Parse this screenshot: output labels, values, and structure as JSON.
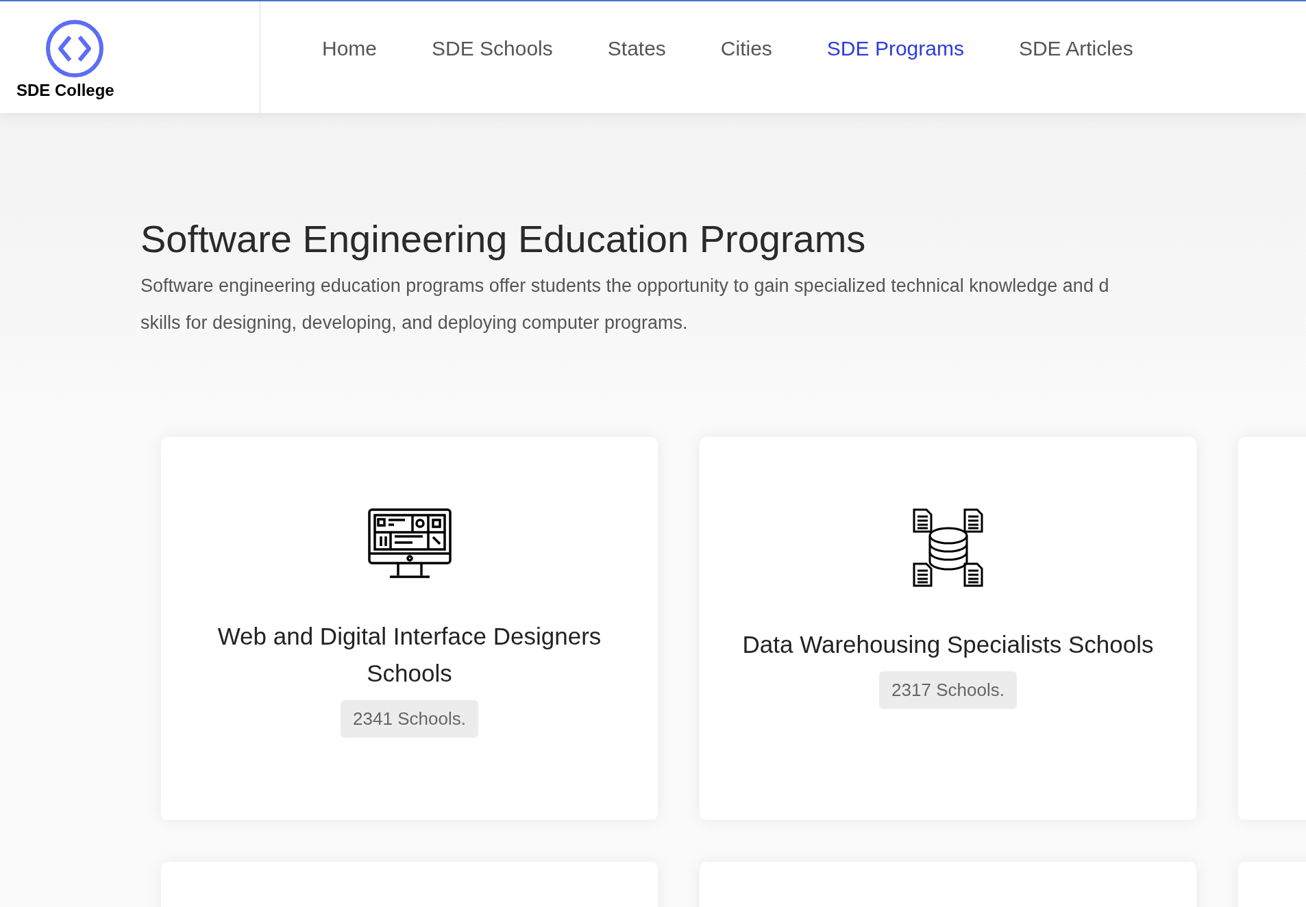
{
  "logo": {
    "text": "SDE College"
  },
  "nav": [
    {
      "label": "Home",
      "selected": false
    },
    {
      "label": "SDE Schools",
      "selected": false
    },
    {
      "label": "States",
      "selected": false
    },
    {
      "label": "Cities",
      "selected": false
    },
    {
      "label": "SDE Programs",
      "selected": true
    },
    {
      "label": "SDE Articles",
      "selected": false
    }
  ],
  "hero": {
    "title": "Software Engineering Education Programs",
    "description_lines": [
      "Software engineering education programs offer students the opportunity to gain specialized technical knowledge and d",
      "skills for designing, developing, and deploying computer programs."
    ]
  },
  "programs": [
    {
      "kind": "monitor",
      "title": "Web and Digital Interface Designers Schools",
      "count": "2341 Schools."
    },
    {
      "kind": "database",
      "title": "Data Warehousing Specialists Schools",
      "count": "2317 Schools."
    }
  ]
}
